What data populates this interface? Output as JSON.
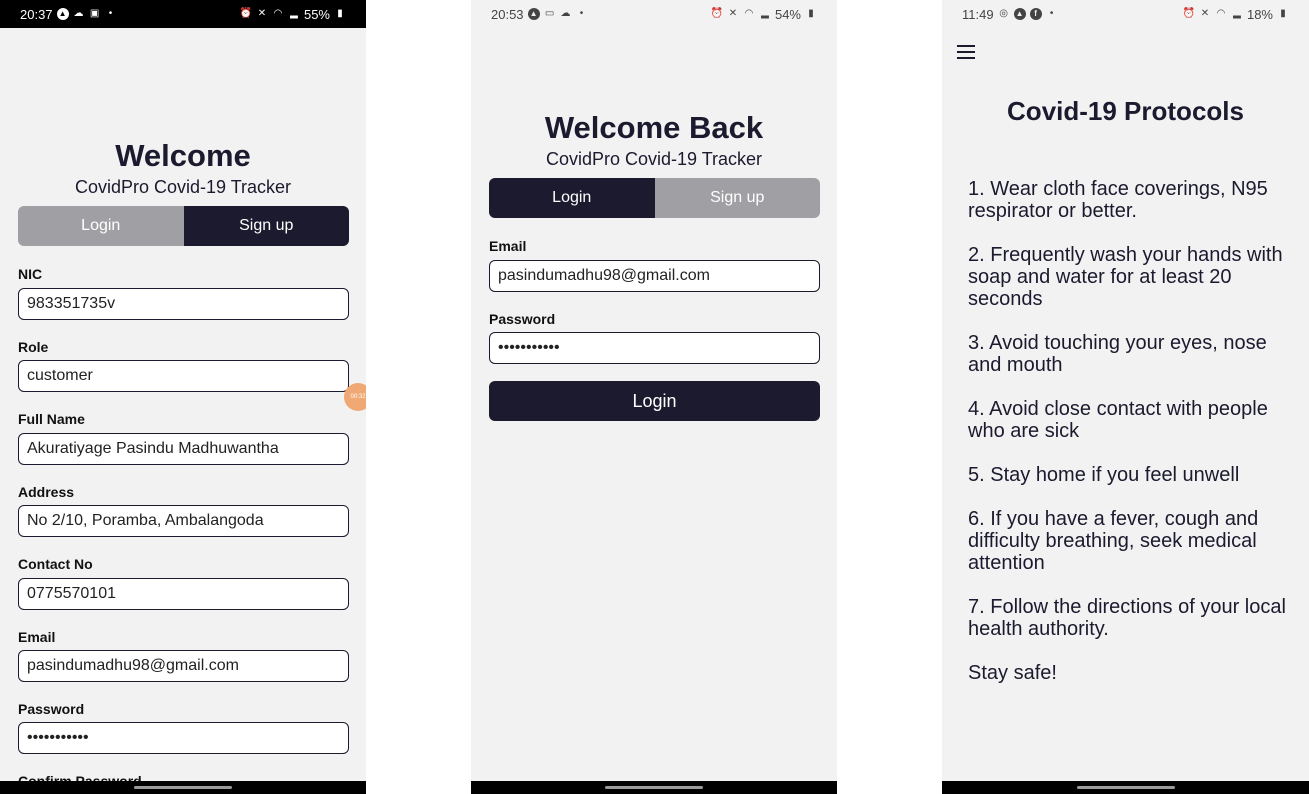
{
  "screens": {
    "signup": {
      "status_bar": {
        "time": "20:37",
        "battery": "55%"
      },
      "title": "Welcome",
      "subtitle": "CovidPro Covid-19 Tracker",
      "tabs": {
        "login": "Login",
        "signup": "Sign up",
        "active": "signup"
      },
      "fields": [
        {
          "label": "NIC",
          "value": "983351735v"
        },
        {
          "label": "Role",
          "value": "customer"
        },
        {
          "label": "Full Name",
          "value": "Akuratiyage Pasindu Madhuwantha"
        },
        {
          "label": "Address",
          "value": "No 2/10, Poramba, Ambalangoda"
        },
        {
          "label": "Contact No",
          "value": "0775570101"
        },
        {
          "label": "Email",
          "value": "pasindumadhu98@gmail.com"
        },
        {
          "label": "Password",
          "value": "•••••••••••"
        },
        {
          "label": "Confirm Password",
          "value": ""
        }
      ],
      "bubble_text": "00:32"
    },
    "login": {
      "status_bar": {
        "time": "20:53",
        "battery": "54%"
      },
      "title": "Welcome Back",
      "subtitle": "CovidPro Covid-19 Tracker",
      "tabs": {
        "login": "Login",
        "signup": "Sign up",
        "active": "login"
      },
      "fields": [
        {
          "label": "Email",
          "value": "pasindumadhu98@gmail.com"
        },
        {
          "label": "Password",
          "value": "•••••••••••"
        }
      ],
      "submit_label": "Login"
    },
    "protocols": {
      "status_bar": {
        "time": "11:49",
        "battery": "18%"
      },
      "title": "Covid-19 Protocols",
      "items": [
        "1. Wear cloth face coverings, N95 respirator or better.",
        "2. Frequently wash your hands with soap and water for at least 20 seconds",
        "3. Avoid touching your eyes, nose and mouth",
        "4. Avoid close contact with people who are sick",
        "5. Stay home if you feel unwell",
        "6. If you have a fever, cough and difficulty breathing, seek medical attention",
        "7. Follow the directions of your local health authority.",
        "Stay safe!"
      ]
    }
  },
  "icons": {
    "status_left": [
      "navigation-icon",
      "cloud-icon",
      "notification-icon"
    ],
    "status_right": [
      "alarm-icon",
      "mute-icon",
      "wifi-icon",
      "signal-icon",
      "battery-icon"
    ]
  },
  "colors": {
    "primary": "#1b1a2e",
    "inactive_tab": "#a0a0a4",
    "background": "#f2f2f2",
    "bubble": "#f0a874"
  }
}
